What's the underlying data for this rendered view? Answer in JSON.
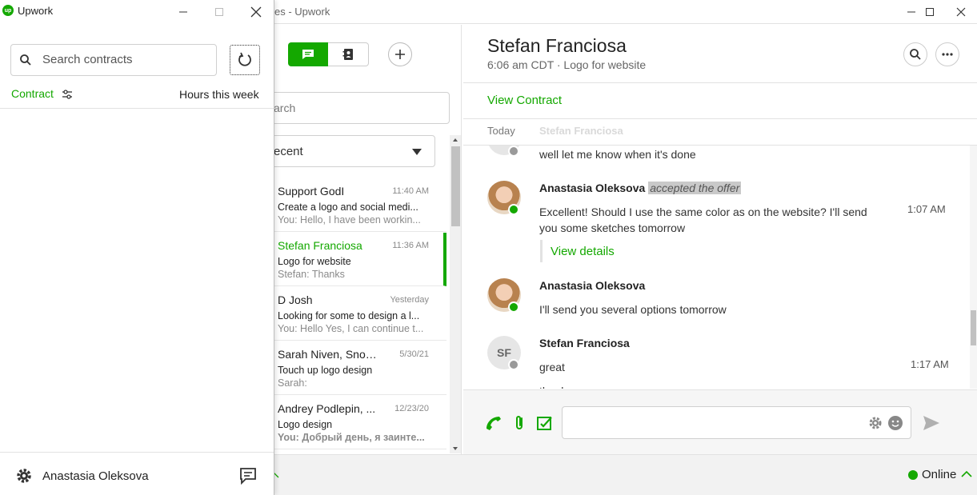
{
  "main_window": {
    "title": "es - Upwork"
  },
  "contracts_window": {
    "title": "Upwork",
    "logo_text": "up",
    "search_placeholder": "Search contracts",
    "contract_label": "Contract",
    "hours_label": "Hours this week",
    "user_name": "Anastasia Oleksova"
  },
  "conversations": {
    "search_placeholder": "arch",
    "filter_value": "ecent",
    "items": [
      {
        "name": "Support GodI",
        "time": "11:40 AM",
        "subject": "Create a logo and social medi...",
        "preview": "You: Hello, I have been workin..."
      },
      {
        "name": "Stefan Franciosa",
        "time": "11:36 AM",
        "subject": "Logo for website",
        "preview": "Stefan: Thanks",
        "active": true
      },
      {
        "name": "D Josh",
        "time": "Yesterday",
        "subject": "Looking for some to design a l...",
        "preview": "You: Hello Yes, I can continue t..."
      },
      {
        "name": "Sarah Niven, Snow...",
        "time": "5/30/21",
        "subject": "Touch up logo design",
        "preview": "Sarah:"
      },
      {
        "name": "Andrey Podlepin, ...",
        "time": "12/23/20",
        "subject": "Logo design",
        "preview": "You: Добрый день, я заинте..."
      }
    ]
  },
  "chat": {
    "name": "Stefan Franciosa",
    "subline": "6:06 am CDT · Logo for website",
    "view_contract": "View Contract",
    "day_label": "Today",
    "ghost_name": "Stefan Franciosa",
    "messages": {
      "m0_text": "well let me know when it's done",
      "m1_author": "Anastasia Oleksova",
      "m1_badge": "accepted the offer",
      "m1_text_line1": "Excellent! Should I use the same color as on the website? I'll send",
      "m1_text_line2": "you some sketches tomorrow",
      "m1_time": "1:07 AM",
      "m1_link": "View details",
      "m2_author": "Anastasia Oleksova",
      "m2_text": "I'll send you several options tomorrow",
      "m3_initials": "SF",
      "m3_author": "Stefan Franciosa",
      "m3_text": "great",
      "m3_time": "1:17 AM",
      "m4_text": "thanks"
    }
  },
  "status": {
    "label": "Online"
  },
  "colors": {
    "brand_green": "#14a800"
  }
}
